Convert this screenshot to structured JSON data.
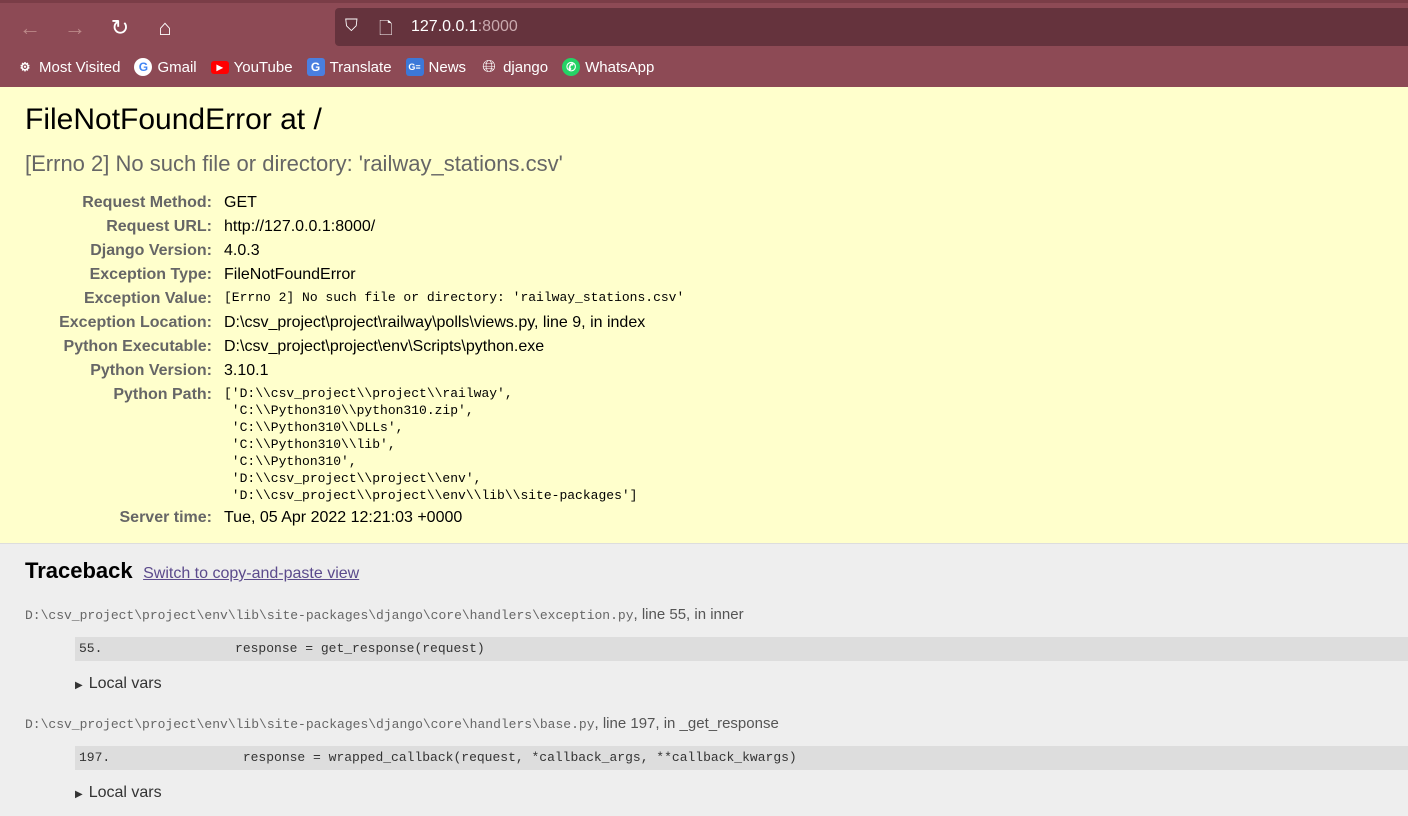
{
  "browser": {
    "url_host": "127.0.0.1",
    "url_port": ":8000",
    "bookmarks": [
      {
        "label": "Most Visited",
        "icon": "gear-icon"
      },
      {
        "label": "Gmail",
        "icon": "google-icon"
      },
      {
        "label": "YouTube",
        "icon": "youtube-icon"
      },
      {
        "label": "Translate",
        "icon": "translate-icon"
      },
      {
        "label": "News",
        "icon": "news-icon"
      },
      {
        "label": "django",
        "icon": "globe-icon"
      },
      {
        "label": "WhatsApp",
        "icon": "whatsapp-icon"
      }
    ]
  },
  "summary": {
    "title": "FileNotFoundError at /",
    "message": "[Errno 2] No such file or directory: 'railway_stations.csv'",
    "rows": [
      {
        "label": "Request Method:",
        "value": "GET"
      },
      {
        "label": "Request URL:",
        "value": "http://127.0.0.1:8000/"
      },
      {
        "label": "Django Version:",
        "value": "4.0.3"
      },
      {
        "label": "Exception Type:",
        "value": "FileNotFoundError"
      },
      {
        "label": "Exception Value:",
        "value": "[Errno 2] No such file or directory: 'railway_stations.csv'"
      },
      {
        "label": "Exception Location:",
        "value": "D:\\csv_project\\project\\railway\\polls\\views.py, line 9, in index"
      },
      {
        "label": "Python Executable:",
        "value": "D:\\csv_project\\project\\env\\Scripts\\python.exe"
      },
      {
        "label": "Python Version:",
        "value": "3.10.1"
      },
      {
        "label": "Python Path:",
        "value": "['D:\\\\csv_project\\\\project\\\\railway',\n 'C:\\\\Python310\\\\python310.zip',\n 'C:\\\\Python310\\\\DLLs',\n 'C:\\\\Python310\\\\lib',\n 'C:\\\\Python310',\n 'D:\\\\csv_project\\\\project\\\\env',\n 'D:\\\\csv_project\\\\project\\\\env\\\\lib\\\\site-packages']"
      },
      {
        "label": "Server time:",
        "value": "Tue, 05 Apr 2022 12:21:03 +0000"
      }
    ]
  },
  "traceback": {
    "title": "Traceback",
    "switch_link": "Switch to copy-and-paste view",
    "frames": [
      {
        "path": "D:\\csv_project\\project\\env\\lib\\site-packages\\django\\core\\handlers\\exception.py",
        "where": ", line 55, in inner",
        "code": "55.                 response = get_response(request)",
        "local_vars": "Local vars"
      },
      {
        "path": "D:\\csv_project\\project\\env\\lib\\site-packages\\django\\core\\handlers\\base.py",
        "where": ", line 197, in _get_response",
        "code": "197.                 response = wrapped_callback(request, *callback_args, **callback_kwargs)",
        "local_vars": "Local vars"
      }
    ]
  }
}
